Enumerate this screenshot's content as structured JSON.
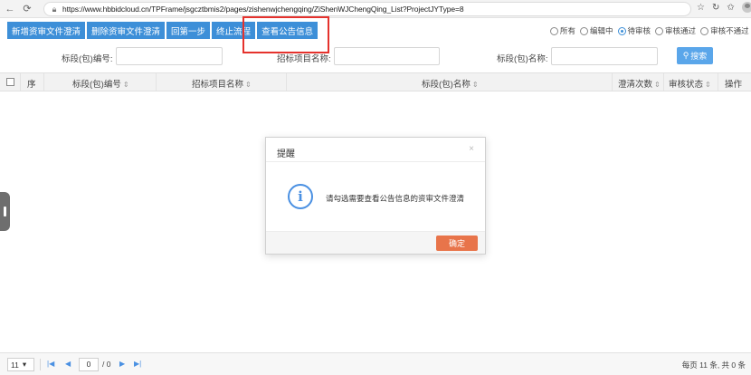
{
  "browser": {
    "url": "https://www.hbbidcloud.cn/TPFrame/jsgcztbmis2/pages/zishenwjchengqing/ZiShenWJChengQing_List?ProjectJYType=8",
    "nav_icons": [
      "back-arrow-icon",
      "refresh-icon"
    ],
    "right_icons": [
      "star-icon",
      "sync-icon",
      "favorites-icon",
      "profile-icon",
      "more-icon"
    ]
  },
  "toolbar": {
    "buttons": [
      "新增资审文件澄清",
      "删除资审文件澄清",
      "回第一步",
      "终止流程",
      "查看公告信息"
    ]
  },
  "filters": {
    "options": [
      {
        "label": "所有",
        "checked": false
      },
      {
        "label": "编辑中",
        "checked": false
      },
      {
        "label": "待审核",
        "checked": true
      },
      {
        "label": "审核通过",
        "checked": false
      },
      {
        "label": "审核不通过",
        "checked": false
      }
    ]
  },
  "search": {
    "bdbh_label": "标段(包)编号:",
    "zbxmmc_label": "招标项目名称:",
    "bdmc_label": "标段(包)名称:",
    "button_label": "搜索"
  },
  "table": {
    "columns": [
      "序",
      "标段(包)编号",
      "招标项目名称",
      "标段(包)名称",
      "澄清次数",
      "审核状态",
      "操作"
    ],
    "sortable": [
      false,
      true,
      true,
      true,
      true,
      true,
      false
    ],
    "rows": []
  },
  "pager": {
    "page_size": "11",
    "current_page": "0",
    "total_pages_text": "/ 0",
    "info": "每页 11 条, 共 0 条"
  },
  "modal": {
    "title": "提醒",
    "message": "请勾选需要查看公告信息的资审文件澄清",
    "ok_label": "确定",
    "close_symbol": "×"
  },
  "colors": {
    "primary": "#3d8fd8",
    "highlight": "#e5322d",
    "ok_button": "#e8744a"
  }
}
